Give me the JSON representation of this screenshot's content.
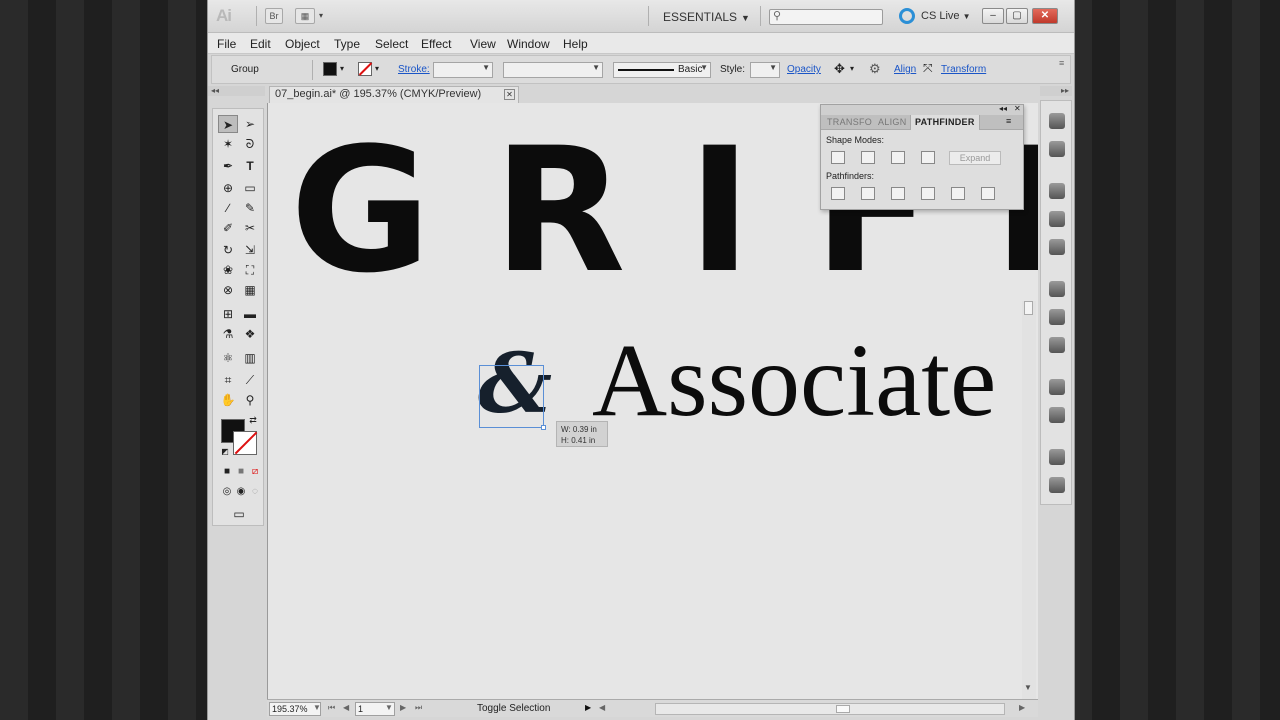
{
  "titlebar": {
    "logo": "Ai",
    "bridge_label": "Br",
    "workspace": "ESSENTIALS",
    "search_icon": "magnifier-icon",
    "cslive": "CS Live",
    "minimize": "‒",
    "maximize": "▢",
    "close": "✕"
  },
  "menu": [
    "File",
    "Edit",
    "Object",
    "Type",
    "Select",
    "Effect",
    "View",
    "Window",
    "Help"
  ],
  "control": {
    "selection": "Group",
    "stroke_label": "Stroke:",
    "brush_label": "Basic",
    "style_label": "Style:",
    "opacity_label": "Opacity",
    "align_label": "Align",
    "transform_label": "Transform",
    "fill_color": "#111111",
    "stroke_none_color": "#d11111"
  },
  "document": {
    "tab_title": "07_begin.ai* @ 195.37% (CMYK/Preview)",
    "close": "✕"
  },
  "artwork": {
    "headline": "GRIFF",
    "ampersand": "&",
    "subhead": "Associate"
  },
  "tooltip": {
    "width": "W: 0.39 in",
    "height": "H: 0.41 in"
  },
  "pathfinder_panel": {
    "tabs": [
      "TRANSFO",
      "ALIGN",
      "PATHFINDER"
    ],
    "shape_modes_label": "Shape Modes:",
    "expand_label": "Expand",
    "pathfinders_label": "Pathfinders:"
  },
  "status": {
    "zoom": "195.37%",
    "artboard": "1",
    "tool_status": "Toggle Selection"
  },
  "dock": {
    "collapse_left": "◂◂",
    "collapse_right": "▸▸"
  }
}
